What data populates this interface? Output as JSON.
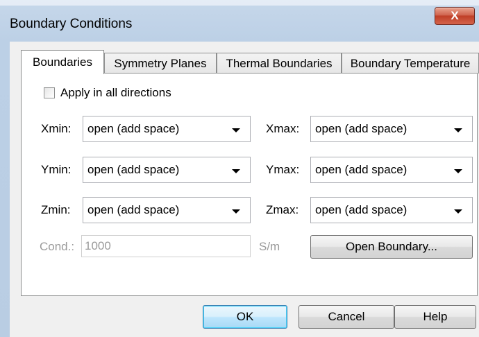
{
  "window": {
    "title": "Boundary Conditions",
    "close_glyph": "X"
  },
  "tabs": [
    {
      "label": "Boundaries",
      "active": true
    },
    {
      "label": "Symmetry Planes",
      "active": false
    },
    {
      "label": "Thermal Boundaries",
      "active": false
    },
    {
      "label": "Boundary Temperature",
      "active": false
    }
  ],
  "apply_all": {
    "label": "Apply in all directions",
    "checked": false
  },
  "fields": {
    "xmin": {
      "label": "Xmin:",
      "value": "open (add space)"
    },
    "xmax": {
      "label": "Xmax:",
      "value": "open (add space)"
    },
    "ymin": {
      "label": "Ymin:",
      "value": "open (add space)"
    },
    "ymax": {
      "label": "Ymax:",
      "value": "open (add space)"
    },
    "zmin": {
      "label": "Zmin:",
      "value": "open (add space)"
    },
    "zmax": {
      "label": "Zmax:",
      "value": "open (add space)"
    }
  },
  "cond": {
    "label": "Cond.:",
    "value": "1000",
    "unit": "S/m"
  },
  "buttons": {
    "open_boundary": "Open Boundary...",
    "ok": "OK",
    "cancel": "Cancel",
    "help": "Help"
  },
  "colors": {
    "close_button": "#c7432b",
    "default_button_border": "#3c7fb1",
    "frame": "#bcd0e6"
  }
}
